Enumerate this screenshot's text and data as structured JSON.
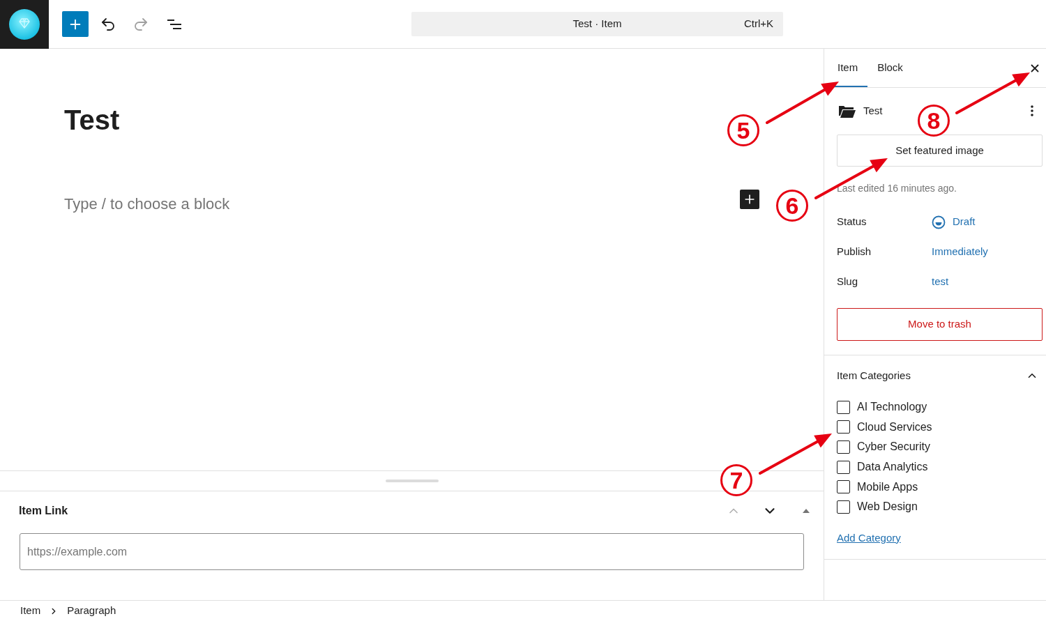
{
  "toolbar": {
    "undo": {
      "disabled": false
    },
    "redo": {
      "disabled": true
    }
  },
  "command_bar": {
    "title": "Test · Item",
    "shortcut": "Ctrl+K"
  },
  "editor": {
    "title": "Test",
    "block_placeholder": "Type / to choose a block"
  },
  "meta_box": {
    "title": "Item Link",
    "expanded": true,
    "move_up": {
      "disabled": true
    },
    "move_down": {
      "disabled": false
    },
    "field": {
      "placeholder": "https://example.com"
    }
  },
  "breadcrumb": [
    "Item",
    "Paragraph"
  ],
  "sidebar": {
    "tabs": [
      {
        "label": "Item",
        "selected": true
      },
      {
        "label": "Block",
        "selected": false
      }
    ],
    "item": {
      "title": "Test"
    },
    "featured_image_button": "Set featured image",
    "last_edited": "Last edited 16 minutes ago.",
    "fields": [
      {
        "kind": "status",
        "label": "Status",
        "value": "Draft"
      },
      {
        "kind": "link",
        "label": "Publish",
        "value": "Immediately"
      },
      {
        "kind": "link",
        "label": "Slug",
        "value": "test"
      }
    ],
    "trash_button": "Move to trash",
    "categories": {
      "title": "Item Categories",
      "expanded": true,
      "items": [
        {
          "label": "AI Technology",
          "checked": false
        },
        {
          "label": "Cloud Services",
          "checked": false
        },
        {
          "label": "Cyber Security",
          "checked": false
        },
        {
          "label": "Data Analytics",
          "checked": false
        },
        {
          "label": "Mobile Apps",
          "checked": false
        },
        {
          "label": "Web Design",
          "checked": false
        }
      ],
      "add_link": "Add Category"
    }
  },
  "annotations": [
    {
      "number": "5"
    },
    {
      "number": "6"
    },
    {
      "number": "7"
    },
    {
      "number": "8"
    }
  ]
}
